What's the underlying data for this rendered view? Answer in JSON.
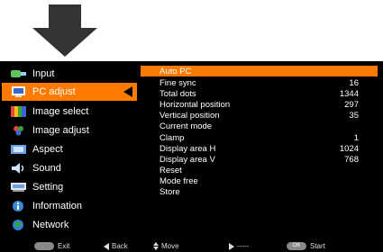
{
  "left_menu": {
    "items": [
      {
        "label": "Input",
        "icon": "input-icon"
      },
      {
        "label": "PC adjust",
        "icon": "pc-adjust-icon",
        "active": true
      },
      {
        "label": "Image select",
        "icon": "image-select-icon"
      },
      {
        "label": "Image adjust",
        "icon": "image-adjust-icon"
      },
      {
        "label": "Aspect",
        "icon": "aspect-icon"
      },
      {
        "label": "Sound",
        "icon": "sound-icon"
      },
      {
        "label": "Setting",
        "icon": "setting-icon"
      },
      {
        "label": "Information",
        "icon": "information-icon"
      },
      {
        "label": "Network",
        "icon": "network-icon"
      }
    ]
  },
  "submenu": {
    "items": [
      {
        "label": "Auto PC",
        "value": "",
        "active": true
      },
      {
        "label": "Fine sync",
        "value": "16"
      },
      {
        "label": "Total dots",
        "value": "1344"
      },
      {
        "label": "Horizontal position",
        "value": "297"
      },
      {
        "label": "Vertical position",
        "value": "35"
      },
      {
        "label": "Current mode",
        "value": ""
      },
      {
        "label": "Clamp",
        "value": "1"
      },
      {
        "label": "Display area H",
        "value": "1024"
      },
      {
        "label": "Display area V",
        "value": "768"
      },
      {
        "label": "Reset",
        "value": ""
      },
      {
        "label": "Mode free",
        "value": ""
      },
      {
        "label": "Store",
        "value": ""
      }
    ]
  },
  "bottom_bar": {
    "exit": "Exit",
    "back": "Back",
    "move": "Move",
    "dashes": "-----",
    "start": "Start",
    "ok_badge": "OK"
  },
  "colors": {
    "accent": "#ff7a00",
    "background": "#000000",
    "text": "#ffffff"
  }
}
